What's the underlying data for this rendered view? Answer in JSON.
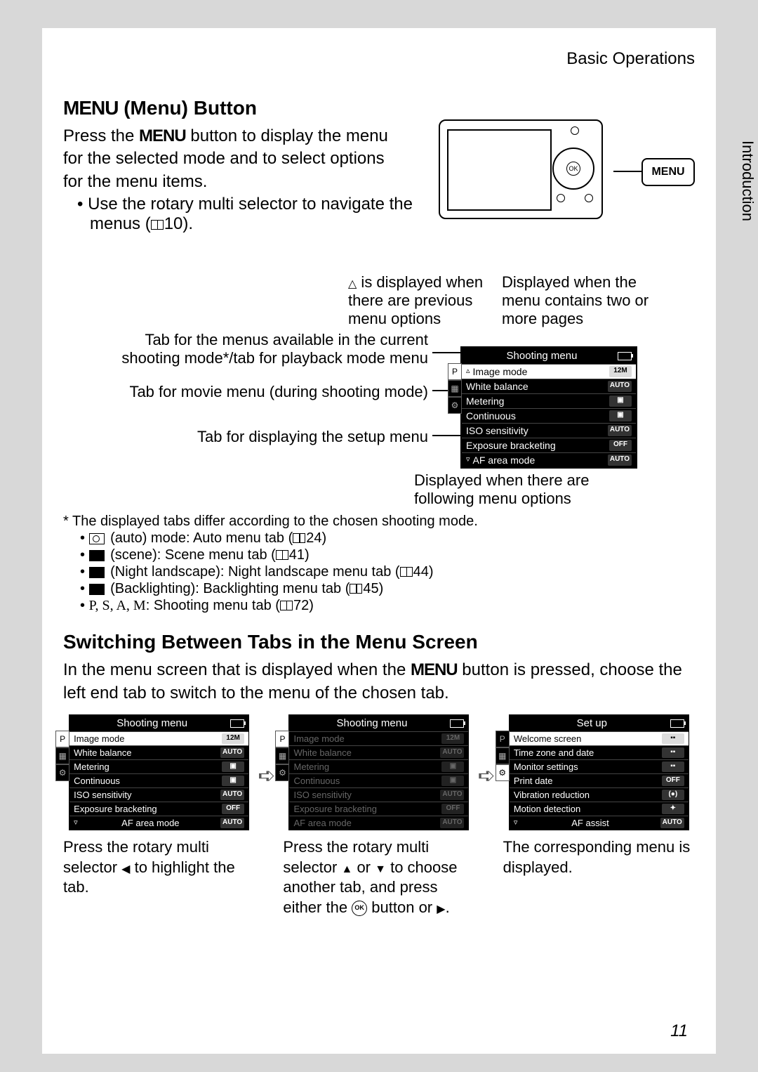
{
  "header": {
    "breadcrumb": "Basic Operations",
    "side_tab": "Introduction"
  },
  "section1": {
    "menu_word": "MENU",
    "title_rest": " (Menu) Button",
    "intro_1": "Press the ",
    "intro_2": " button to display the menu for the selected mode and to select options for the menu items.",
    "bullet_1a": "Use the rotary multi selector to navigate the menus (",
    "bullet_1b": "10)."
  },
  "camera": {
    "menu_label": "MENU"
  },
  "anno": {
    "prev_a": " is displayed when there are previous menu options",
    "pages": "Displayed when the menu contains two or more pages",
    "tab_shoot": "Tab for the menus available in the current shooting mode*/tab for playback mode menu",
    "tab_movie": "Tab for movie menu (during shooting mode)",
    "tab_setup": "Tab for displaying the setup menu",
    "follow": "Displayed when there are following menu options"
  },
  "menu_main": {
    "title": "Shooting menu",
    "rows": [
      {
        "label": "Image mode",
        "val": "12M"
      },
      {
        "label": "White balance",
        "val": "AUTO"
      },
      {
        "label": "Metering",
        "val": "▣"
      },
      {
        "label": "Continuous",
        "val": "▣"
      },
      {
        "label": "ISO sensitivity",
        "val": "AUTO"
      },
      {
        "label": "Exposure bracketing",
        "val": "OFF"
      },
      {
        "label": "AF area mode",
        "val": "AUTO"
      }
    ],
    "tabs": [
      "P",
      "▦",
      "⚙"
    ]
  },
  "footnote_lead": "*  The displayed tabs differ according to the chosen shooting mode.",
  "modes": [
    {
      "icon": "camera",
      "text_a": " (auto) mode: Auto menu tab (",
      "text_b": "24)"
    },
    {
      "icon": "scene",
      "text_a": " (scene): Scene menu tab (",
      "text_b": "41)"
    },
    {
      "icon": "night",
      "text_a": " (Night landscape): Night landscape menu tab (",
      "text_b": "44)"
    },
    {
      "icon": "back",
      "text_a": " (Backlighting): Backlighting menu tab (",
      "text_b": "45)"
    },
    {
      "icon": "psam",
      "psam": "P, S, A, M",
      "text_a": ": Shooting menu tab (",
      "text_b": "72)"
    }
  ],
  "section2": {
    "title": "Switching Between Tabs in the Menu Screen",
    "intro_a": "In the menu screen that is displayed when the ",
    "intro_b": " button is pressed, choose the left end tab to switch to the menu of the chosen tab."
  },
  "step1": {
    "title": "Shooting menu",
    "rows": [
      {
        "label": "Image mode",
        "val": "12M"
      },
      {
        "label": "White balance",
        "val": "AUTO"
      },
      {
        "label": "Metering",
        "val": "▣"
      },
      {
        "label": "Continuous",
        "val": "▣"
      },
      {
        "label": "ISO sensitivity",
        "val": "AUTO"
      },
      {
        "label": "Exposure bracketing",
        "val": "OFF"
      },
      {
        "label": "AF area mode",
        "val": "AUTO"
      }
    ],
    "caption_a": "Press the rotary multi selector ",
    "caption_b": " to highlight the tab."
  },
  "step2": {
    "title": "Shooting menu",
    "rows": [
      {
        "label": "Image mode",
        "val": "12M"
      },
      {
        "label": "White balance",
        "val": "AUTO"
      },
      {
        "label": "Metering",
        "val": "▣"
      },
      {
        "label": "Continuous",
        "val": "▣"
      },
      {
        "label": "ISO sensitivity",
        "val": "AUTO"
      },
      {
        "label": "Exposure bracketing",
        "val": "OFF"
      },
      {
        "label": "AF area mode",
        "val": "AUTO"
      }
    ],
    "caption_a": "Press the rotary multi selector ",
    "caption_b": " or ",
    "caption_c": " to choose another tab, and press either the ",
    "caption_d": " button or "
  },
  "step3": {
    "title": "Set up",
    "rows": [
      {
        "label": "Welcome screen",
        "val": "▪▪"
      },
      {
        "label": "Time zone and date",
        "val": "▪▪"
      },
      {
        "label": "Monitor settings",
        "val": "▪▪"
      },
      {
        "label": "Print date",
        "val": "OFF"
      },
      {
        "label": "Vibration reduction",
        "val": "(●)"
      },
      {
        "label": "Motion detection",
        "val": "✦"
      },
      {
        "label": "AF assist",
        "val": "AUTO"
      }
    ],
    "caption": "The corresponding menu is displayed."
  },
  "page_number": "11",
  "glyphs": {
    "tri_up": "△",
    "tri_down": "▽",
    "tri_left": "◀",
    "tri_right": "▶",
    "ok": "OK"
  }
}
